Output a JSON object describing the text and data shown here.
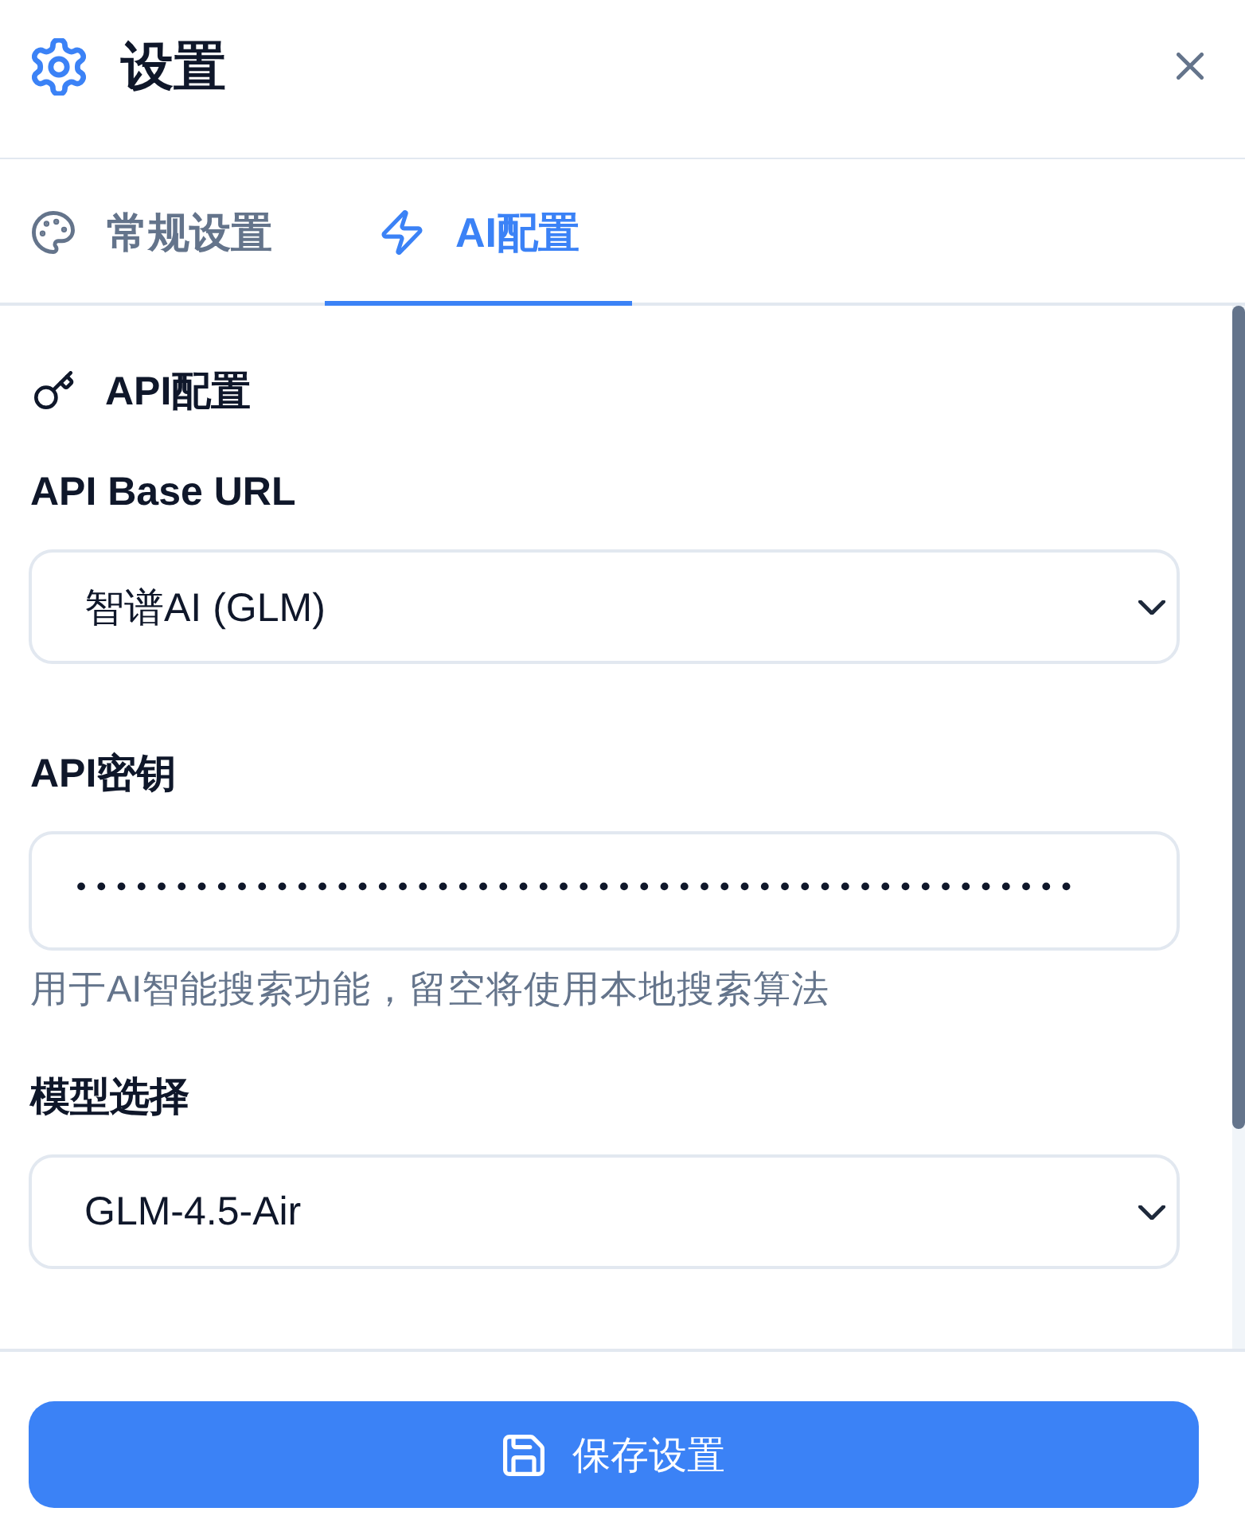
{
  "header": {
    "title": "设置"
  },
  "tabs": [
    {
      "kind": "general",
      "label": "常规设置",
      "selected": false
    },
    {
      "kind": "ai",
      "label": "AI配置",
      "selected": true
    }
  ],
  "section": {
    "title": "API配置"
  },
  "fields": [
    {
      "kind": "select",
      "label": "API Base URL",
      "value": "智谱AI (GLM)"
    },
    {
      "kind": "password",
      "label": "API密钥",
      "value": "••••••••••••••••••••••••••••••••••••••••••••••••••",
      "hint": "用于AI智能搜索功能，留空将使用本地搜索算法"
    },
    {
      "kind": "select",
      "label": "模型选择",
      "value": "GLM-4.5-Air"
    }
  ],
  "save_button": {
    "label": "保存设置"
  }
}
